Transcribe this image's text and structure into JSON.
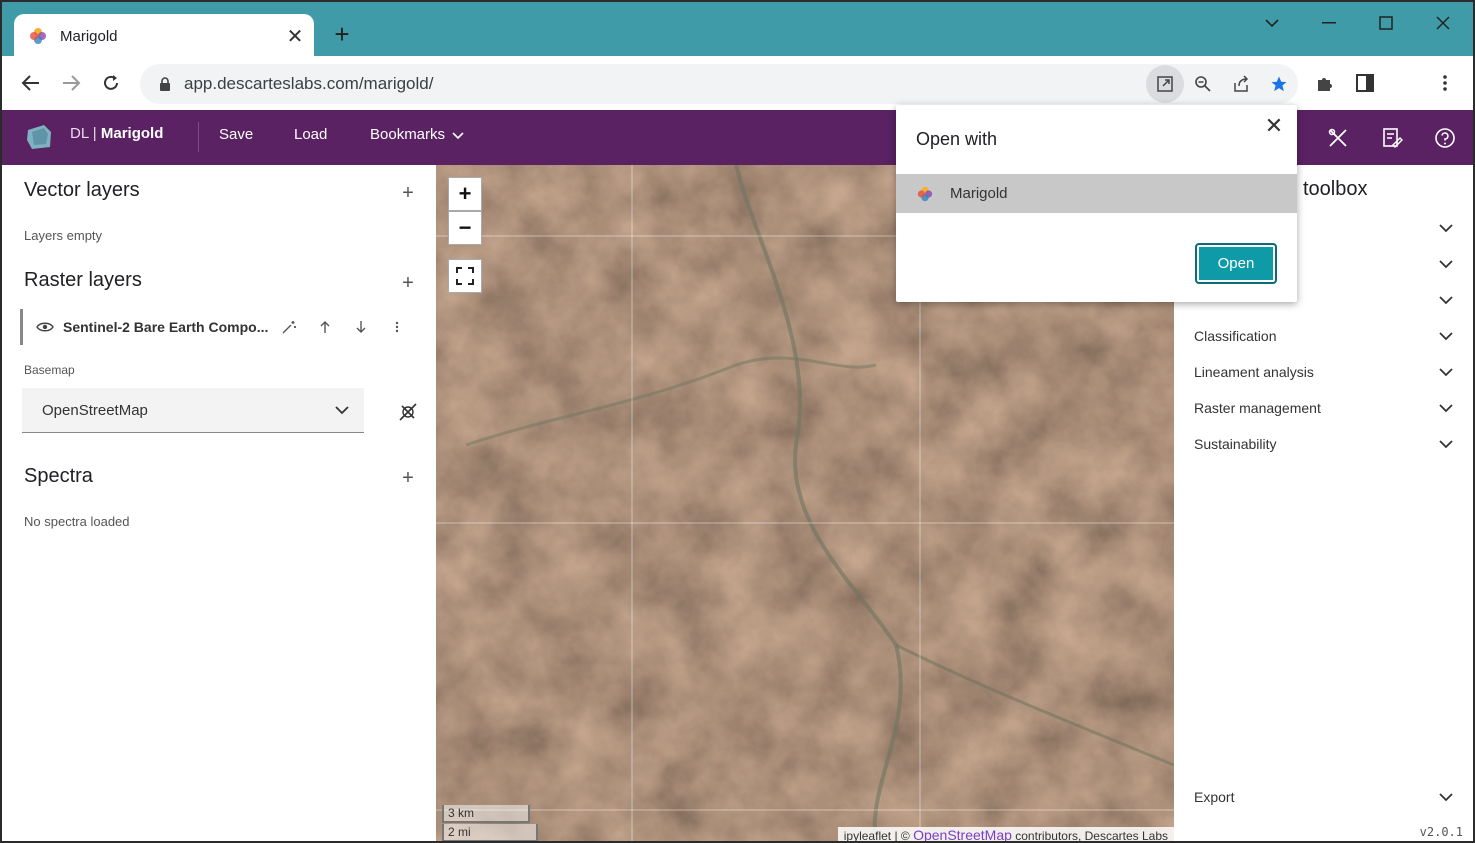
{
  "browser": {
    "tab_title": "Marigold",
    "url": "app.descarteslabs.com/marigold/"
  },
  "app": {
    "brand_prefix": "DL | ",
    "brand_name": "Marigold",
    "menu": {
      "save": "Save",
      "load": "Load",
      "bookmarks": "Bookmarks"
    }
  },
  "left_panel": {
    "vector_title": "Vector layers",
    "vector_empty": "Layers empty",
    "raster_title": "Raster layers",
    "raster_layers": [
      {
        "name": "Sentinel-2 Bare Earth Compo..."
      }
    ],
    "basemap_label": "Basemap",
    "basemap_value": "OpenStreetMap",
    "spectra_title": "Spectra",
    "spectra_empty": "No spectra loaded"
  },
  "map": {
    "zoom_in": "+",
    "zoom_out": "−",
    "scale_km": "3 km",
    "scale_mi": "2 mi",
    "attribution_prefix": "ipyleaflet | © ",
    "attribution_link": "OpenStreetMap",
    "attribution_suffix": " contributors, Descartes Labs"
  },
  "toolbox": {
    "title": "toolbox",
    "sections": [
      "",
      "",
      "",
      "Classification",
      "Lineament analysis",
      "Raster management",
      "Sustainability"
    ],
    "export": "Export",
    "version": "v2.0.1"
  },
  "popup": {
    "title": "Open with",
    "option": "Marigold",
    "open_button": "Open"
  },
  "colors": {
    "titlebar": "#3f9ba7",
    "appbar": "#5a2163",
    "accent_button": "#0f9aa8",
    "star": "#1a73e8"
  }
}
